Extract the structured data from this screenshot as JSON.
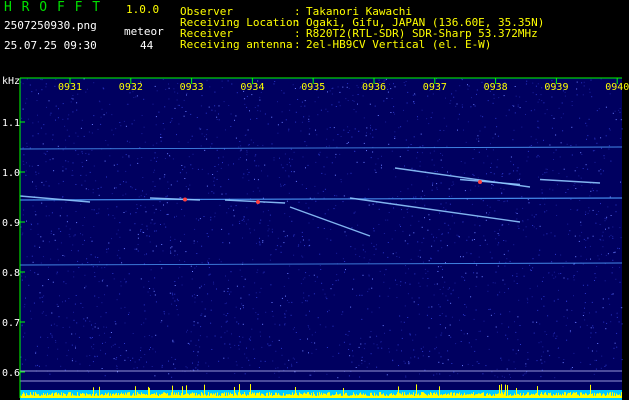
{
  "header": {
    "app_title": "H R O F F T",
    "version": "1.0.0",
    "filename": "2507250930.png",
    "datetime": "25.07.25 09:30",
    "meteor_label": "meteor",
    "meteor_count": "44",
    "info": [
      {
        "label": "Observer",
        "sep": ":",
        "value": "Takanori Kawachi"
      },
      {
        "label": "Receiving Location",
        "sep": ":",
        "value": "Ogaki, Gifu, JAPAN (136.60E, 35.35N)"
      },
      {
        "label": "Receiver",
        "sep": ":",
        "value": "R820T2(RTL-SDR) SDR-Sharp 53.372MHz"
      },
      {
        "label": "Receiving antenna",
        "sep": ":",
        "value": "2el-HB9CV Vertical (el. E-W)"
      }
    ]
  },
  "chart_data": {
    "type": "heatmap",
    "xlabel": "",
    "ylabel": "kHz",
    "x_ticks": [
      "0931",
      "0932",
      "0933",
      "0934",
      "0935",
      "0936",
      "0937",
      "0938",
      "0939",
      "0940"
    ],
    "y_ticks": [
      "1.1",
      "1.0",
      "0.9",
      "0.8",
      "0.7",
      "0.6"
    ],
    "ylim": [
      0.58,
      1.18
    ],
    "background_color": "#000060",
    "axis_color": "#00ff00",
    "trace_color": "#4fa0ff",
    "meteor_head_color": "#ff4040",
    "bottom_bar_color": "#ffff00",
    "bottom_fill_color": "#00c8ff"
  }
}
